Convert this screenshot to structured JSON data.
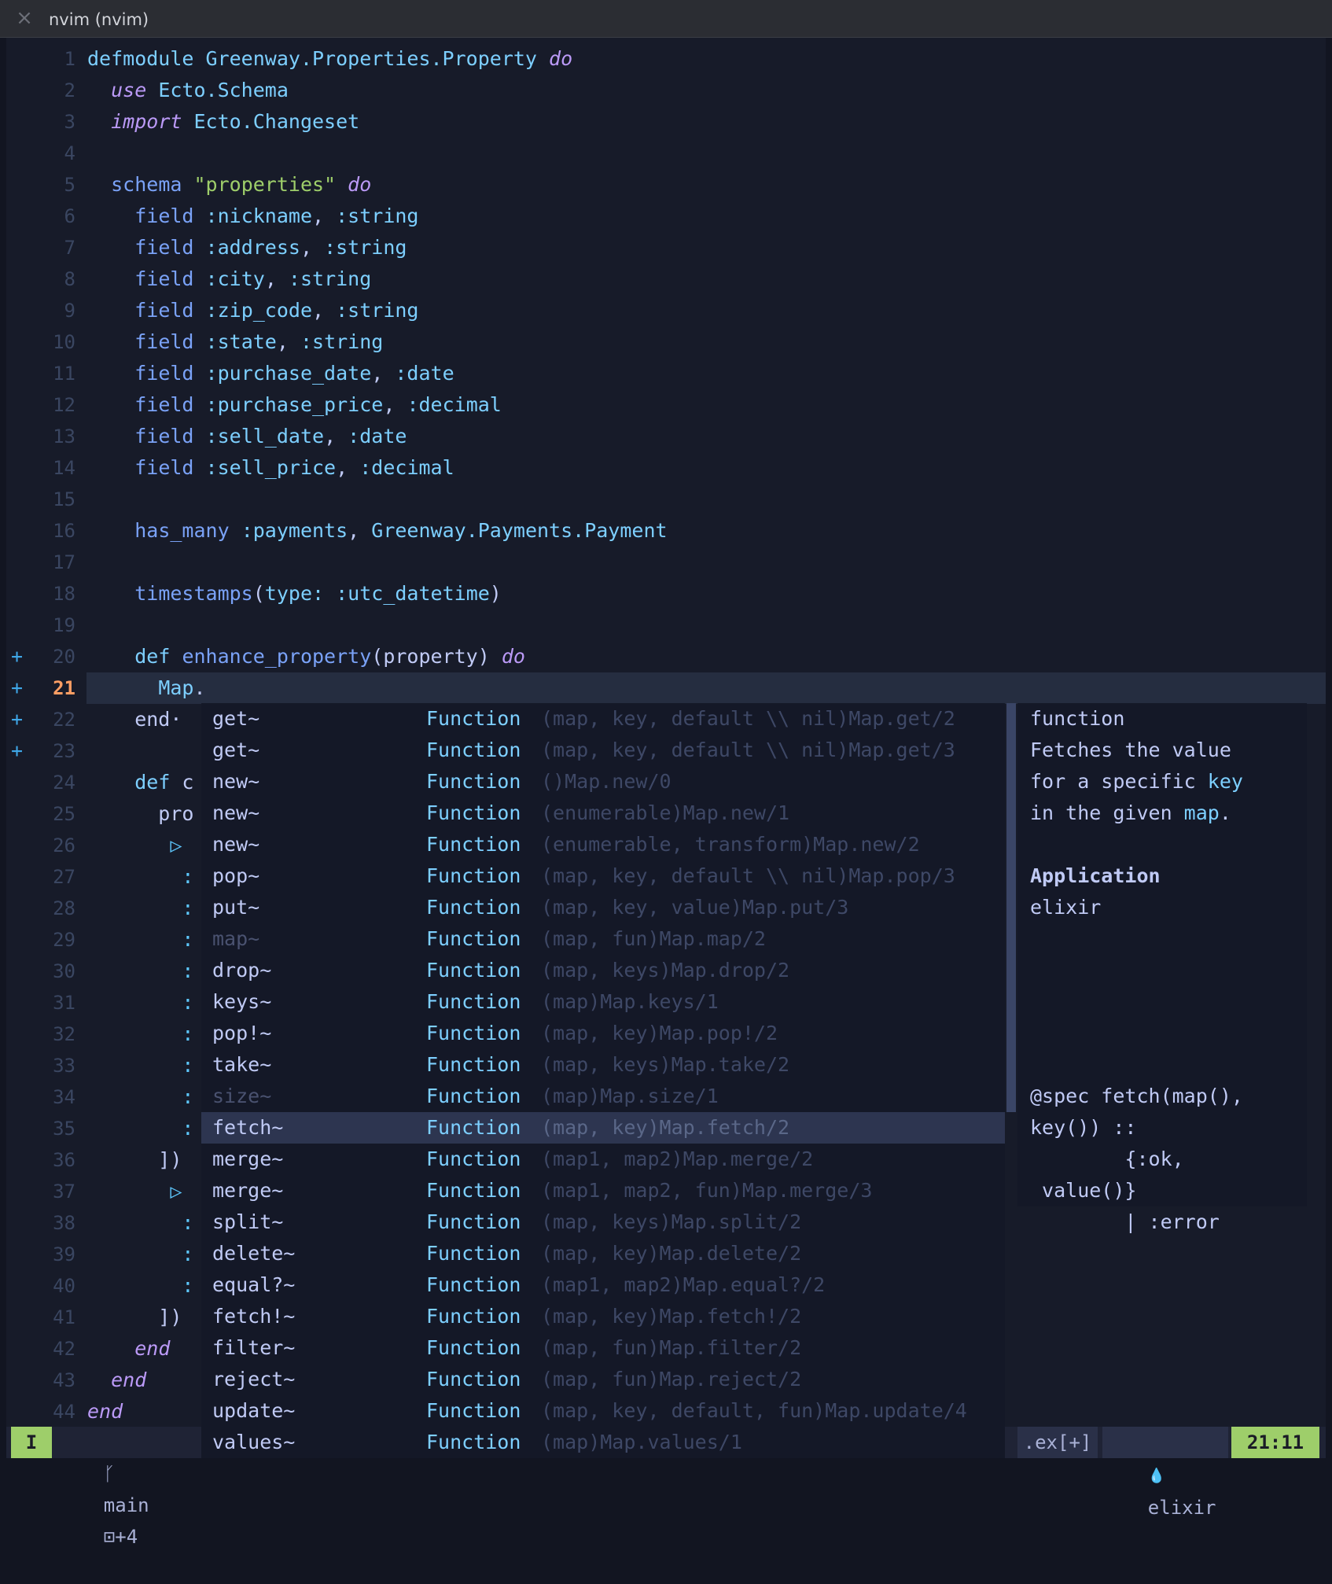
{
  "window": {
    "title": "nvim (nvim)",
    "close_icon": "×"
  },
  "lines": [
    {
      "n": "1",
      "sign": "",
      "tokens": [
        [
          "kw",
          "defmodule"
        ],
        [
          "pl",
          " "
        ],
        [
          "mod",
          "Greenway.Properties.Property"
        ],
        [
          "pl",
          " "
        ],
        [
          "kwi",
          "do"
        ]
      ]
    },
    {
      "n": "2",
      "sign": "",
      "tokens": [
        [
          "pl",
          "  "
        ],
        [
          "kwi",
          "use"
        ],
        [
          "pl",
          " "
        ],
        [
          "mod",
          "Ecto.Schema"
        ]
      ]
    },
    {
      "n": "3",
      "sign": "",
      "tokens": [
        [
          "pl",
          "  "
        ],
        [
          "kwi",
          "import"
        ],
        [
          "pl",
          " "
        ],
        [
          "mod",
          "Ecto.Changeset"
        ]
      ]
    },
    {
      "n": "4",
      "sign": "",
      "tokens": []
    },
    {
      "n": "5",
      "sign": "",
      "tokens": [
        [
          "pl",
          "  "
        ],
        [
          "fn",
          "schema"
        ],
        [
          "pl",
          " "
        ],
        [
          "str",
          "\"properties\""
        ],
        [
          "pl",
          " "
        ],
        [
          "kwi",
          "do"
        ]
      ]
    },
    {
      "n": "6",
      "sign": "",
      "tokens": [
        [
          "pl",
          "    "
        ],
        [
          "fn",
          "field"
        ],
        [
          "pl",
          " "
        ],
        [
          "atom",
          ":nickname"
        ],
        [
          "pl",
          ", "
        ],
        [
          "atom",
          ":string"
        ]
      ]
    },
    {
      "n": "7",
      "sign": "",
      "tokens": [
        [
          "pl",
          "    "
        ],
        [
          "fn",
          "field"
        ],
        [
          "pl",
          " "
        ],
        [
          "atom",
          ":address"
        ],
        [
          "pl",
          ", "
        ],
        [
          "atom",
          ":string"
        ]
      ]
    },
    {
      "n": "8",
      "sign": "",
      "tokens": [
        [
          "pl",
          "    "
        ],
        [
          "fn",
          "field"
        ],
        [
          "pl",
          " "
        ],
        [
          "atom",
          ":city"
        ],
        [
          "pl",
          ", "
        ],
        [
          "atom",
          ":string"
        ]
      ]
    },
    {
      "n": "9",
      "sign": "",
      "tokens": [
        [
          "pl",
          "    "
        ],
        [
          "fn",
          "field"
        ],
        [
          "pl",
          " "
        ],
        [
          "atom",
          ":zip_code"
        ],
        [
          "pl",
          ", "
        ],
        [
          "atom",
          ":string"
        ]
      ]
    },
    {
      "n": "10",
      "sign": "",
      "tokens": [
        [
          "pl",
          "    "
        ],
        [
          "fn",
          "field"
        ],
        [
          "pl",
          " "
        ],
        [
          "atom",
          ":state"
        ],
        [
          "pl",
          ", "
        ],
        [
          "atom",
          ":string"
        ]
      ]
    },
    {
      "n": "11",
      "sign": "",
      "tokens": [
        [
          "pl",
          "    "
        ],
        [
          "fn",
          "field"
        ],
        [
          "pl",
          " "
        ],
        [
          "atom",
          ":purchase_date"
        ],
        [
          "pl",
          ", "
        ],
        [
          "atom",
          ":date"
        ]
      ]
    },
    {
      "n": "12",
      "sign": "",
      "tokens": [
        [
          "pl",
          "    "
        ],
        [
          "fn",
          "field"
        ],
        [
          "pl",
          " "
        ],
        [
          "atom",
          ":purchase_price"
        ],
        [
          "pl",
          ", "
        ],
        [
          "atom",
          ":decimal"
        ]
      ]
    },
    {
      "n": "13",
      "sign": "",
      "tokens": [
        [
          "pl",
          "    "
        ],
        [
          "fn",
          "field"
        ],
        [
          "pl",
          " "
        ],
        [
          "atom",
          ":sell_date"
        ],
        [
          "pl",
          ", "
        ],
        [
          "atom",
          ":date"
        ]
      ]
    },
    {
      "n": "14",
      "sign": "",
      "tokens": [
        [
          "pl",
          "    "
        ],
        [
          "fn",
          "field"
        ],
        [
          "pl",
          " "
        ],
        [
          "atom",
          ":sell_price"
        ],
        [
          "pl",
          ", "
        ],
        [
          "atom",
          ":decimal"
        ]
      ]
    },
    {
      "n": "15",
      "sign": "",
      "tokens": []
    },
    {
      "n": "16",
      "sign": "",
      "tokens": [
        [
          "pl",
          "    "
        ],
        [
          "fn",
          "has_many"
        ],
        [
          "pl",
          " "
        ],
        [
          "atom",
          ":payments"
        ],
        [
          "pl",
          ", "
        ],
        [
          "mod",
          "Greenway.Payments.Payment"
        ]
      ]
    },
    {
      "n": "17",
      "sign": "",
      "tokens": []
    },
    {
      "n": "18",
      "sign": "",
      "tokens": [
        [
          "pl",
          "    "
        ],
        [
          "fn",
          "timestamps"
        ],
        [
          "pl",
          "("
        ],
        [
          "atom",
          "type:"
        ],
        [
          "pl",
          " "
        ],
        [
          "atom",
          ":utc_datetime"
        ],
        [
          "pl",
          ")"
        ]
      ]
    },
    {
      "n": "19",
      "sign": "",
      "tokens": []
    },
    {
      "n": "20",
      "sign": "+",
      "tokens": [
        [
          "pl",
          "    "
        ],
        [
          "kw",
          "def"
        ],
        [
          "pl",
          " "
        ],
        [
          "fn",
          "enhance_property"
        ],
        [
          "pl",
          "(property) "
        ],
        [
          "kwi",
          "do"
        ]
      ]
    },
    {
      "n": "21",
      "sign": "+",
      "tokens": [
        [
          "pl",
          "      "
        ],
        [
          "mod",
          "Map"
        ],
        [
          "pl",
          "."
        ]
      ],
      "cursor": true
    },
    {
      "n": "22",
      "sign": "+",
      "tokens": [
        [
          "pl",
          "    end·"
        ]
      ]
    },
    {
      "n": "23",
      "sign": "+",
      "tokens": []
    },
    {
      "n": "24",
      "sign": "",
      "tokens": [
        [
          "pl",
          "    "
        ],
        [
          "kw",
          "def"
        ],
        [
          "pl",
          " c"
        ]
      ]
    },
    {
      "n": "25",
      "sign": "",
      "tokens": [
        [
          "pl",
          "      pro"
        ]
      ]
    },
    {
      "n": "26",
      "sign": "",
      "tokens": [
        [
          "pl",
          "       "
        ],
        [
          "tri",
          "▷"
        ]
      ]
    },
    {
      "n": "27",
      "sign": "",
      "tokens": [
        [
          "pl",
          "        "
        ],
        [
          "tri",
          ":"
        ]
      ]
    },
    {
      "n": "28",
      "sign": "",
      "tokens": [
        [
          "pl",
          "        "
        ],
        [
          "tri",
          ":"
        ]
      ]
    },
    {
      "n": "29",
      "sign": "",
      "tokens": [
        [
          "pl",
          "        "
        ],
        [
          "tri",
          ":"
        ]
      ]
    },
    {
      "n": "30",
      "sign": "",
      "tokens": [
        [
          "pl",
          "        "
        ],
        [
          "tri",
          ":"
        ]
      ]
    },
    {
      "n": "31",
      "sign": "",
      "tokens": [
        [
          "pl",
          "        "
        ],
        [
          "tri",
          ":"
        ]
      ]
    },
    {
      "n": "32",
      "sign": "",
      "tokens": [
        [
          "pl",
          "        "
        ],
        [
          "tri",
          ":"
        ]
      ]
    },
    {
      "n": "33",
      "sign": "",
      "tokens": [
        [
          "pl",
          "        "
        ],
        [
          "tri",
          ":"
        ]
      ]
    },
    {
      "n": "34",
      "sign": "",
      "tokens": [
        [
          "pl",
          "        "
        ],
        [
          "tri",
          ":"
        ]
      ]
    },
    {
      "n": "35",
      "sign": "",
      "tokens": [
        [
          "pl",
          "        "
        ],
        [
          "tri",
          ":"
        ]
      ]
    },
    {
      "n": "36",
      "sign": "",
      "tokens": [
        [
          "pl",
          "      ])"
        ]
      ]
    },
    {
      "n": "37",
      "sign": "",
      "tokens": [
        [
          "pl",
          "       "
        ],
        [
          "tri",
          "▷"
        ]
      ]
    },
    {
      "n": "38",
      "sign": "",
      "tokens": [
        [
          "pl",
          "        "
        ],
        [
          "tri",
          ":"
        ]
      ]
    },
    {
      "n": "39",
      "sign": "",
      "tokens": [
        [
          "pl",
          "        "
        ],
        [
          "tri",
          ":"
        ]
      ]
    },
    {
      "n": "40",
      "sign": "",
      "tokens": [
        [
          "pl",
          "        "
        ],
        [
          "tri",
          ":"
        ]
      ]
    },
    {
      "n": "41",
      "sign": "",
      "tokens": [
        [
          "pl",
          "      ])"
        ]
      ]
    },
    {
      "n": "42",
      "sign": "",
      "tokens": [
        [
          "pl",
          "    "
        ],
        [
          "kwi",
          "end"
        ]
      ]
    },
    {
      "n": "43",
      "sign": "",
      "tokens": [
        [
          "pl",
          "  "
        ],
        [
          "kwi",
          "end"
        ]
      ]
    },
    {
      "n": "44",
      "sign": "",
      "tokens": [
        [
          "kwi",
          "end"
        ]
      ]
    }
  ],
  "completion": {
    "items": [
      {
        "word": "get~",
        "kind": "Function",
        "detail": "(map, key, default \\\\ nil)Map.get/2"
      },
      {
        "word": "get~",
        "kind": "Function",
        "detail": "(map, key, default \\\\ nil)Map.get/3"
      },
      {
        "word": "new~",
        "kind": "Function",
        "detail": "()Map.new/0"
      },
      {
        "word": "new~",
        "kind": "Function",
        "detail": "(enumerable)Map.new/1"
      },
      {
        "word": "new~",
        "kind": "Function",
        "detail": "(enumerable, transform)Map.new/2"
      },
      {
        "word": "pop~",
        "kind": "Function",
        "detail": "(map, key, default \\\\ nil)Map.pop/3"
      },
      {
        "word": "put~",
        "kind": "Function",
        "detail": "(map, key, value)Map.put/3"
      },
      {
        "word": "map~",
        "kind": "Function",
        "detail": "(map, fun)Map.map/2",
        "dim": true
      },
      {
        "word": "drop~",
        "kind": "Function",
        "detail": "(map, keys)Map.drop/2"
      },
      {
        "word": "keys~",
        "kind": "Function",
        "detail": "(map)Map.keys/1"
      },
      {
        "word": "pop!~",
        "kind": "Function",
        "detail": "(map, key)Map.pop!/2"
      },
      {
        "word": "take~",
        "kind": "Function",
        "detail": "(map, keys)Map.take/2"
      },
      {
        "word": "size~",
        "kind": "Function",
        "detail": "(map)Map.size/1",
        "dim": true
      },
      {
        "word": "fetch~",
        "kind": "Function",
        "detail": "(map, key)Map.fetch/2",
        "selected": true
      },
      {
        "word": "merge~",
        "kind": "Function",
        "detail": "(map1, map2)Map.merge/2"
      },
      {
        "word": "merge~",
        "kind": "Function",
        "detail": "(map1, map2, fun)Map.merge/3"
      },
      {
        "word": "split~",
        "kind": "Function",
        "detail": "(map, keys)Map.split/2"
      },
      {
        "word": "delete~",
        "kind": "Function",
        "detail": "(map, key)Map.delete/2"
      },
      {
        "word": "equal?~",
        "kind": "Function",
        "detail": "(map1, map2)Map.equal?/2"
      },
      {
        "word": "fetch!~",
        "kind": "Function",
        "detail": "(map, key)Map.fetch!/2"
      },
      {
        "word": "filter~",
        "kind": "Function",
        "detail": "(map, fun)Map.filter/2"
      },
      {
        "word": "reject~",
        "kind": "Function",
        "detail": "(map, fun)Map.reject/2"
      },
      {
        "word": "update~",
        "kind": "Function",
        "detail": "(map, key, default, fun)Map.update/4"
      },
      {
        "word": "values~",
        "kind": "Function",
        "detail": "(map)Map.values/1"
      }
    ]
  },
  "doc": {
    "lines": [
      [
        [
          "t",
          "function"
        ]
      ],
      [
        [
          "t",
          "Fetches the value"
        ]
      ],
      [
        [
          "t",
          "for a specific "
        ],
        [
          "h",
          "key"
        ]
      ],
      [
        [
          "t",
          "in the given "
        ],
        [
          "h",
          "map"
        ],
        [
          "t",
          "."
        ]
      ],
      [],
      [
        [
          "b",
          "Application"
        ]
      ],
      [
        [
          "t",
          "elixir"
        ]
      ],
      [],
      [],
      [],
      [],
      [],
      [
        [
          "t",
          "@spec fetch(map(),"
        ]
      ],
      [
        [
          "t",
          "key()) ::"
        ]
      ],
      [
        [
          "t",
          "        {:ok,"
        ]
      ],
      [
        [
          "t",
          " value()}"
        ]
      ],
      [
        [
          "t",
          "        | :error"
        ]
      ]
    ]
  },
  "status": {
    "mode": "I",
    "branch_icon": "ᚴ",
    "branch": "main",
    "diff_icon": "⊡",
    "diff": "+4",
    "file": ".ex[+]",
    "ft_icon": "💧",
    "filetype": "elixir",
    "position": "21:11"
  }
}
